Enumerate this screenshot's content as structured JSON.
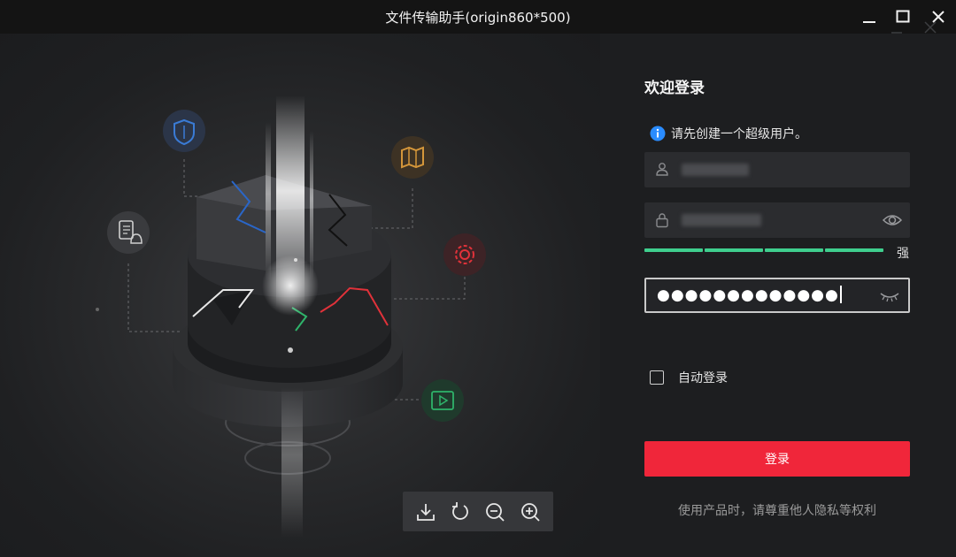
{
  "window": {
    "title": "文件传输助手(origin860*500)",
    "controls": [
      "minimize-icon",
      "maximize-icon",
      "close-icon"
    ]
  },
  "illustration": {
    "feature_icons": [
      "shield-icon",
      "map-icon",
      "document-bell-icon",
      "gear-icon",
      "video-icon"
    ],
    "icon_colors": {
      "shield": "#3a7bd5",
      "map": "#d4963a",
      "document": "#cfcfcf",
      "gear": "#e0323a",
      "video": "#2fb36a"
    }
  },
  "viewer_toolbar": {
    "buttons": [
      "download-icon",
      "rotate-icon",
      "zoom-out-icon",
      "zoom-in-icon"
    ]
  },
  "login": {
    "title": "欢迎登录",
    "info_text": "请先创建一个超级用户。",
    "username_icon": "user-icon",
    "password_icon": "lock-icon",
    "password_strength": {
      "label": "强",
      "level": 4,
      "max": 4,
      "color": "#3fcf8e"
    },
    "confirm_password_value": "●●●●●●●●●●●●●",
    "auto_login": {
      "label": "自动登录",
      "checked": false
    },
    "login_button": "登录",
    "footer_note": "使用产品时，请尊重他人隐私等权利",
    "accent_color": "#f0263a",
    "info_color": "#2a8cff"
  }
}
